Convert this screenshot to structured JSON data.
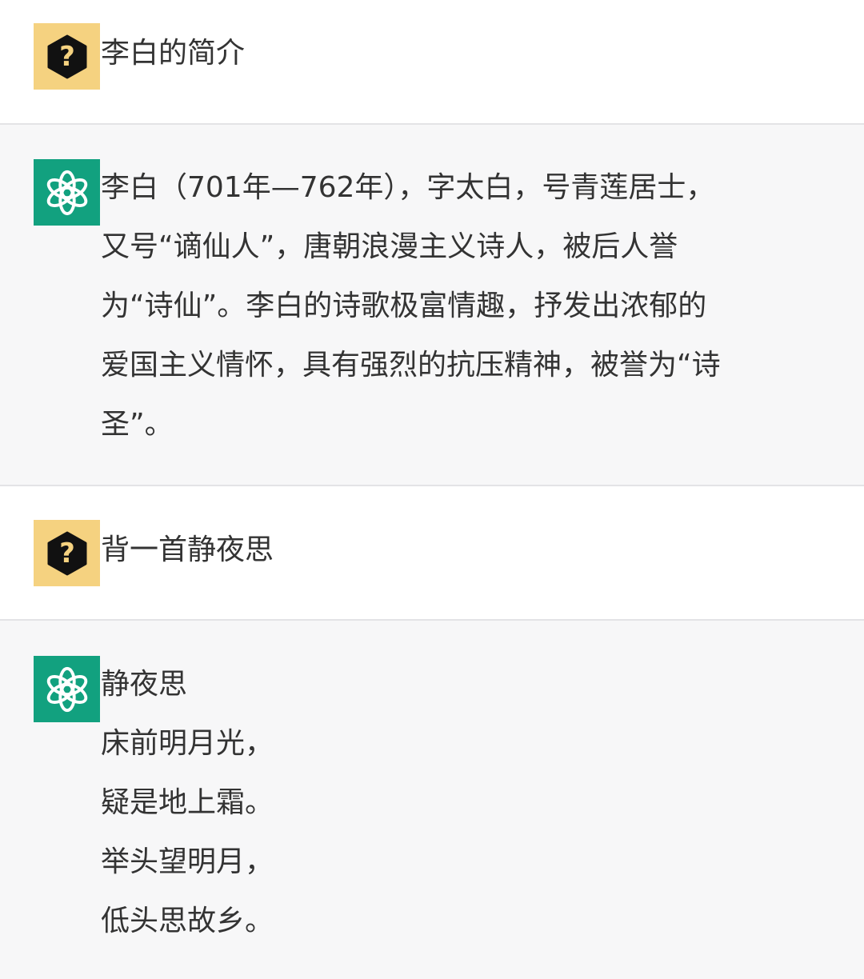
{
  "colors": {
    "user_avatar_bg": "#f5d280",
    "bot_avatar_bg": "#12a17f",
    "bot_message_bg": "#f7f7f8",
    "divider": "#e3e3e6",
    "text": "#333333"
  },
  "messages": [
    {
      "role": "user",
      "avatar_icon": "question-hexagon-icon",
      "text": "李白的简介"
    },
    {
      "role": "assistant",
      "avatar_icon": "openai-logo-icon",
      "lines": [
        "李白（701年—762年），字太白，号青莲居士，",
        "又号“谪仙人”，唐朝浪漫主义诗人，被后人誉",
        "为“诗仙”。李白的诗歌极富情趣，抒发出浓郁的",
        "爱国主义情怀，具有强烈的抗压精神，被誉为“诗",
        "圣”。"
      ]
    },
    {
      "role": "user",
      "avatar_icon": "question-hexagon-icon",
      "text": "背一首静夜思"
    },
    {
      "role": "assistant",
      "avatar_icon": "openai-logo-icon",
      "lines": [
        "静夜思",
        "床前明月光，",
        "疑是地上霜。",
        "举头望明月，",
        "低头思故乡。"
      ]
    }
  ]
}
